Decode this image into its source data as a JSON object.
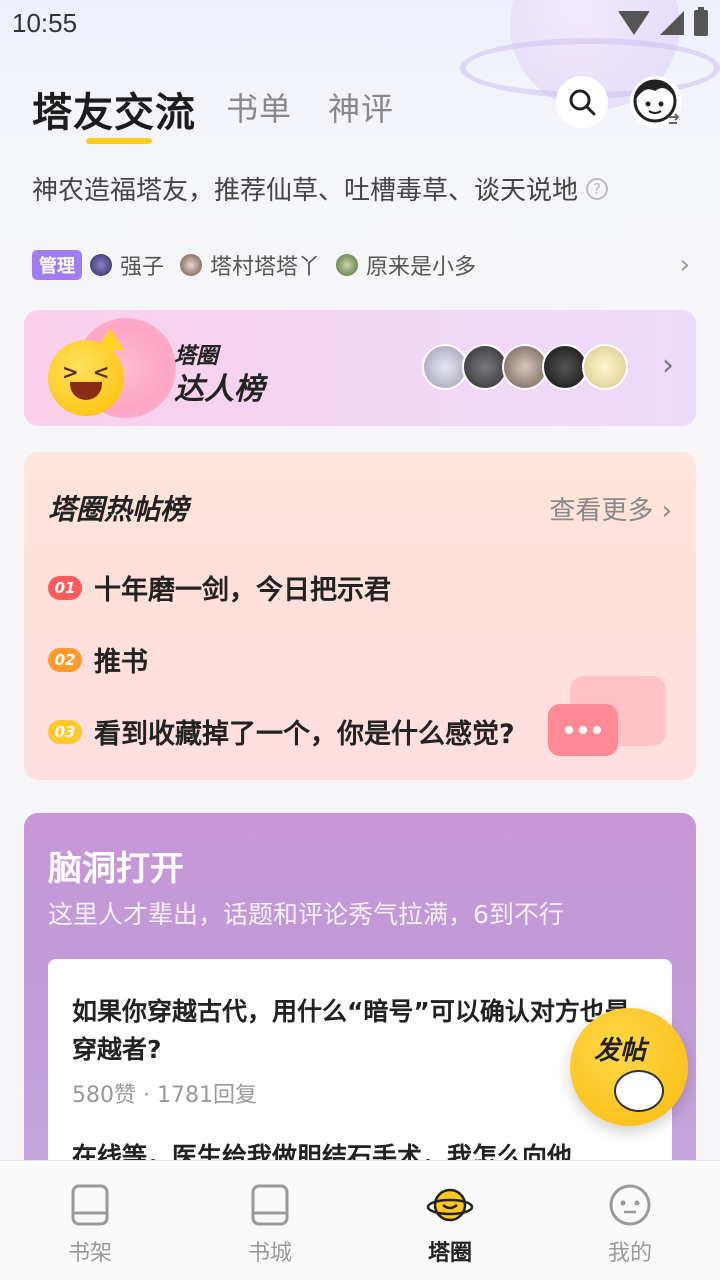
{
  "status_bar": {
    "time": "10:55"
  },
  "header": {
    "tabs": [
      {
        "label": "塔友交流",
        "active": true
      },
      {
        "label": "书单",
        "active": false
      },
      {
        "label": "神评",
        "active": false
      }
    ],
    "search_icon": "search-icon",
    "profile_icon": "face-switch-icon"
  },
  "description": "神农造福塔友，推荐仙草、吐槽毒草、谈天说地",
  "admins": {
    "badge": "管理",
    "names": [
      "强子",
      "塔村塔塔丫",
      "原来是小多"
    ]
  },
  "masters": {
    "title_line1": "塔圈",
    "title_line2": "达人榜",
    "avatar_colors": [
      "#c8c8d8",
      "#4c4c50",
      "#aa9a90",
      "#1e1e22",
      "#efe6b8"
    ]
  },
  "hot_posts": {
    "title": "塔圈热帖榜",
    "more_label": "查看更多",
    "items": [
      {
        "rank": "01",
        "text": "十年磨一剑，今日把示君",
        "color": "#ff5b5b"
      },
      {
        "rank": "02",
        "text": "推书",
        "color": "#ff9a2c"
      },
      {
        "rank": "03",
        "text": "看到收藏掉了一个，你是什么感觉?",
        "color": "#ffc72a"
      }
    ]
  },
  "brainstorm": {
    "title": "脑洞打开",
    "subtitle": "这里人才辈出，话题和评论秀气拉满，6到不行",
    "posts": [
      {
        "title": "如果你穿越古代，用什么“暗号”可以确认对方也是穿越者?",
        "meta": "580赞 · 1781回复"
      },
      {
        "title": "在线等，医生给我做胆结石手术，我怎么向他"
      }
    ]
  },
  "fab": {
    "label": "发帖"
  },
  "bottom_nav": [
    {
      "label": "书架",
      "icon": "bookshelf-icon",
      "active": false
    },
    {
      "label": "书城",
      "icon": "bookstore-icon",
      "active": false
    },
    {
      "label": "塔圈",
      "icon": "planet-icon",
      "active": true
    },
    {
      "label": "我的",
      "icon": "profile-icon",
      "active": false
    }
  ],
  "colors": {
    "accent": "#ffcc1f",
    "admin_badge": "#a27cf2"
  }
}
